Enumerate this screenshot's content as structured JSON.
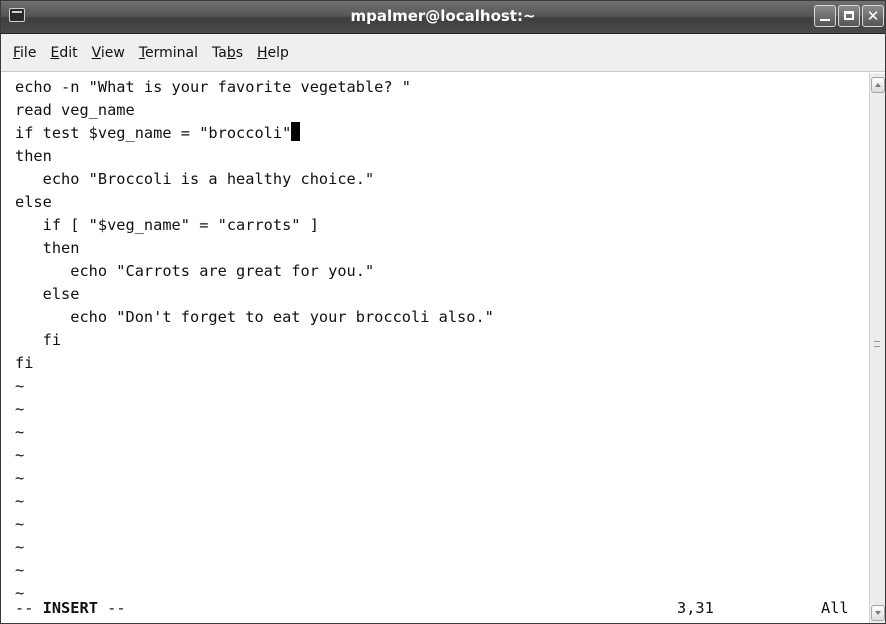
{
  "window": {
    "title": "mpalmer@localhost:~"
  },
  "menubar": {
    "items": [
      {
        "mnemonic": "F",
        "rest": "ile"
      },
      {
        "mnemonic": "E",
        "rest": "dit"
      },
      {
        "mnemonic": "V",
        "rest": "iew"
      },
      {
        "mnemonic": "T",
        "rest": "erminal"
      },
      {
        "pre": "Ta",
        "mnemonic": "b",
        "rest": "s"
      },
      {
        "mnemonic": "H",
        "rest": "elp"
      }
    ]
  },
  "editor": {
    "lines": [
      "echo -n \"What is your favorite vegetable? \"",
      "read veg_name",
      "if test $veg_name = \"broccoli\"",
      "then",
      "   echo \"Broccoli is a healthy choice.\"",
      "else",
      "   if [ \"$veg_name\" = \"carrots\" ]",
      "   then",
      "      echo \"Carrots are great for you.\"",
      "   else",
      "      echo \"Don't forget to eat your broccoli also.\"",
      "   fi",
      "fi",
      "~",
      "~",
      "~",
      "~",
      "~",
      "~",
      "~",
      "~",
      "~",
      "~"
    ],
    "status": {
      "prefix": "-- ",
      "mode": "INSERT",
      "suffix": " --",
      "position": "3,31",
      "scroll": "All"
    }
  },
  "colors": {
    "titlebar": "#4a4a4a",
    "menubar": "#efefef",
    "text": "#111111",
    "background": "#ffffff"
  }
}
